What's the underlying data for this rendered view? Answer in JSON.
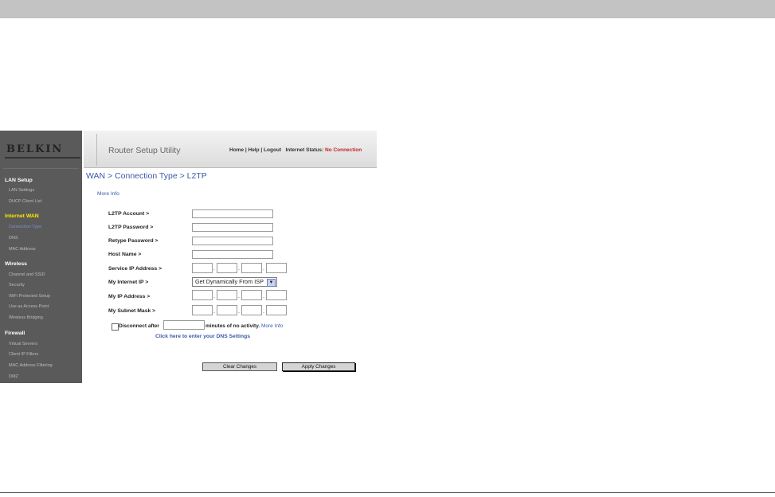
{
  "header": {
    "logo": "BELKIN",
    "app_title": "Router Setup Utility",
    "links": [
      "Home",
      "Help",
      "Logout"
    ],
    "status_label": "Internet Status:",
    "status_value": "No Connection"
  },
  "sidebar": {
    "lan_head": "LAN Setup",
    "lan_items": [
      "LAN Settings",
      "DHCP Client List"
    ],
    "wan_head": "Internet WAN",
    "wan_items": [
      "Connection Type",
      "DNS",
      "MAC Address"
    ],
    "wireless_head": "Wireless",
    "wireless_items": [
      "Channel and SSID",
      "Security",
      "WiFi Protected Setup",
      "Use as Access Point",
      "Wireless Bridging"
    ],
    "firewall_head": "Firewall",
    "firewall_items": [
      "Virtual Servers",
      "Client IP Filters",
      "MAC Address Filtering",
      "DMZ"
    ]
  },
  "main": {
    "title": "WAN > Connection Type > L2TP",
    "more_info": "More Info",
    "fields": {
      "account": "L2TP Account >",
      "password": "L2TP Password >",
      "retype": "Retype Password >",
      "host": "Host Name >",
      "service_ip": "Service IP Address >",
      "internet_ip": "My Internet IP >",
      "my_ip": "My IP Address >",
      "subnet": "My Subnet Mask >"
    },
    "internet_ip_option": "Get Dynamically From ISP",
    "disconnect_label": "Disconnect after",
    "disconnect_suffix": "minutes of no activity.",
    "disconnect_more": "More Info",
    "dns_link": "Click here to enter your DNS Settings",
    "clear_button": "Clear Changes",
    "apply_button": "Apply Changes"
  },
  "colors": {
    "accent": "#3a5aa8",
    "status_red": "#c0262b",
    "sidebar_bg": "#5a5a5a",
    "active_head": "#ffe800"
  }
}
